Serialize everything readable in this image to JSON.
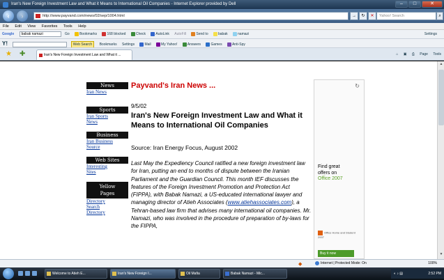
{
  "window": {
    "title": "Iran's New Foreign Investment Law and What it Means to International Oil Companies - Internet Explorer provided by Dell"
  },
  "address_bar": {
    "url": "http://www.payvand.com/news/02/sep/1004.html",
    "search_placeholder": "Yahoo! Search"
  },
  "menu": [
    "File",
    "Edit",
    "View",
    "Favorites",
    "Tools",
    "Help"
  ],
  "google_toolbar": {
    "label": "Google",
    "query": "babak namazi",
    "items": [
      "Go",
      "Bookmarks",
      "168 blocked",
      "Check",
      "AutoLink",
      "AutoFill",
      "Send to",
      "babak",
      "namazi",
      "Settings"
    ]
  },
  "yahoo_toolbar": {
    "label": "Y!",
    "items": [
      "Web Search",
      "Bookmarks",
      "Settings",
      "Mail",
      "My Yahoo!",
      "Answers",
      "Games",
      "Anti-Spy"
    ]
  },
  "tab": {
    "title": "Iran's New Foreign Investment Law and What it ..."
  },
  "command_bar": [
    "Page",
    "Tools"
  ],
  "nav": {
    "sections": [
      {
        "header": "News",
        "links": [
          "Iran News"
        ]
      },
      {
        "header": "Sports",
        "links": [
          "Iran Sports",
          "News"
        ]
      },
      {
        "header": "Business",
        "links": [
          "Iran Business",
          "Source"
        ]
      },
      {
        "header": "Web Sites",
        "links": [
          "Interesting",
          "Sites"
        ]
      },
      {
        "header": "Yellow Pages",
        "links": [
          "Directory",
          "Search",
          "Directory"
        ]
      }
    ]
  },
  "article": {
    "brand": "Payvand's Iran News ...",
    "date": "9/5/02",
    "headline": "Iran's New Foreign Investment Law and What it Means to International Oil Companies",
    "source": "Source: Iran Energy Focus, August 2002",
    "body_before_link": "Last May the Expediency Council ratified a new foreign investment law for Iran, putting an end to months of dispute between the Iranian Parliament and the Guardian Council. This month IEF discusses the features of the Foreign Investment Promotion and Protection Act (FIPPA), with Babak Namazi, a US-educated international lawyer and managing director of Atieh Associates (",
    "link": "www.atiehassociates.com",
    "body_after_link": "), a Tehran-based law firm that advises many international oil companies. Mr. Namazi, who was involved in the procedure of preparation of by-laws for the FIPPA,"
  },
  "ad": {
    "line1": "Find great",
    "line2": "offers on",
    "product": "Office 2007",
    "logo_text": "Office Home and Student 2007",
    "buy": "Buy it now"
  },
  "status": {
    "zone": "Internet | Protected Mode: On",
    "zoom": "100%"
  },
  "taskbar": {
    "tasks": [
      "Welcome to Atieh E...",
      "Iran's New Foreign I...",
      "Oil Mafia",
      "Babak Namazi - Mic..."
    ],
    "clock": "2:52 PM"
  },
  "colors": {
    "brand_red": "#cc0000",
    "link_blue": "#003399",
    "office_green": "#58a021"
  }
}
